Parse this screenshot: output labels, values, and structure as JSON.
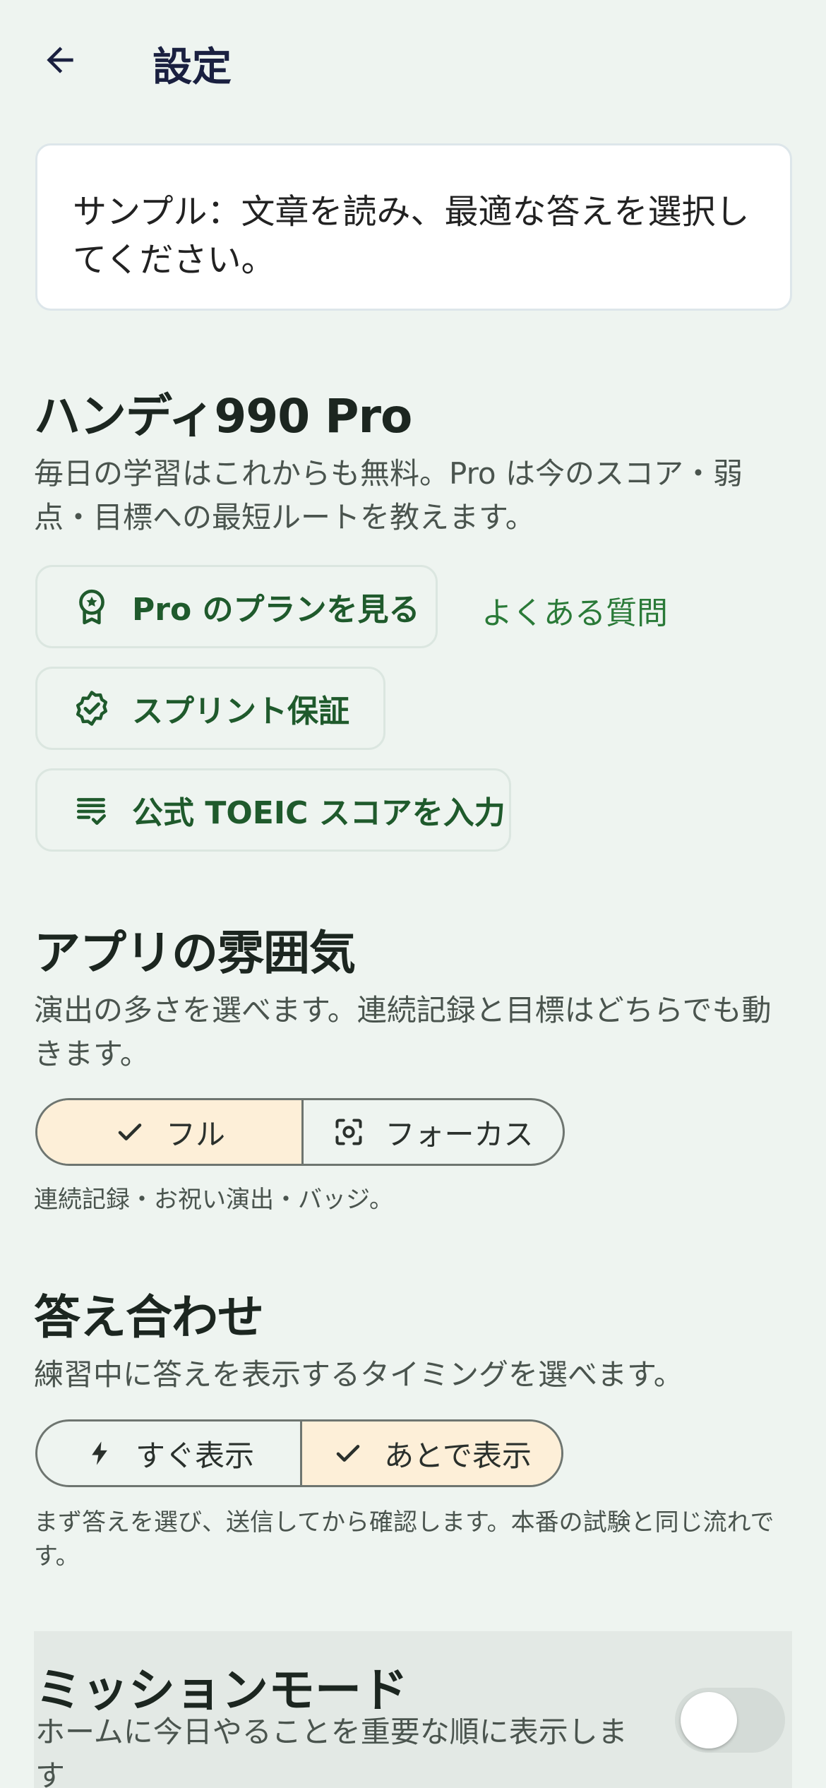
{
  "header": {
    "title": "設定"
  },
  "sample": {
    "text": "サンプル：文章を読み、最適な答えを選択してください。"
  },
  "pro": {
    "title": "ハンディ990 Pro",
    "description": "毎日の学習はこれからも無料。Pro は今のスコア・弱点・目標への最短ルートを教えます。",
    "plans_label": "Pro のプランを見る",
    "faq_label": "よくある質問",
    "sprint_label": "スプリント保証",
    "toeic_label": "公式 TOEIC スコアを入力",
    "accent_color": "#1f5a2c"
  },
  "mood": {
    "title": "アプリの雰囲気",
    "description": "演出の多さを選べます。連続記録と目標はどちらでも動きます。",
    "options": [
      {
        "label": "フル",
        "icon": "check-icon",
        "selected": true
      },
      {
        "label": "フォーカス",
        "icon": "focus-icon",
        "selected": false
      }
    ],
    "note": "連続記録・お祝い演出・バッジ。"
  },
  "answers": {
    "title": "答え合わせ",
    "description": "練習中に答えを表示するタイミングを選べます。",
    "options": [
      {
        "label": "すぐ表示",
        "icon": "bolt-icon",
        "selected": false
      },
      {
        "label": "あとで表示",
        "icon": "check-icon",
        "selected": true
      }
    ],
    "note": "まず答えを選び、送信してから確認します。本番の試験と同じ流れです。",
    "selected_color": "#fdefd8"
  },
  "mission": {
    "title": "ミッションモード",
    "description": "ホームに今日やることを重要な順に表示します",
    "enabled": false
  }
}
